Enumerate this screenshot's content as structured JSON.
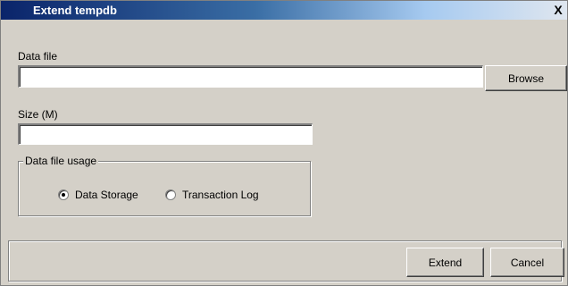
{
  "window": {
    "title": "Extend tempdb",
    "close_symbol": "X"
  },
  "data_file": {
    "label": "Data file",
    "value": "",
    "browse_label": "Browse"
  },
  "size": {
    "label": "Size (M)",
    "value": ""
  },
  "usage": {
    "group_label": "Data file usage",
    "options": [
      {
        "label": "Data Storage",
        "selected": true
      },
      {
        "label": "Transaction Log",
        "selected": false
      }
    ]
  },
  "actions": {
    "extend_label": "Extend",
    "cancel_label": "Cancel"
  }
}
